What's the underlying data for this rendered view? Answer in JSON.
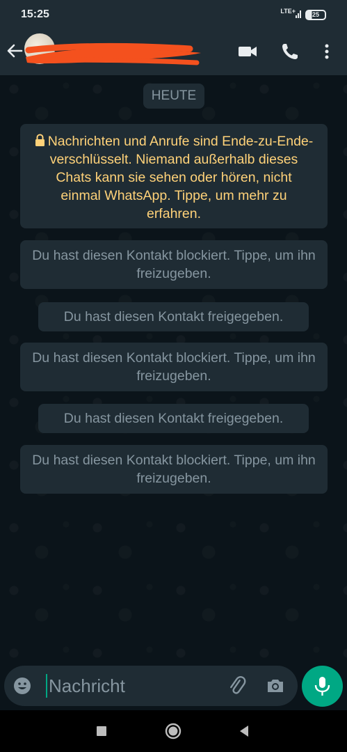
{
  "status_bar": {
    "time": "15:25",
    "network": "LTE+",
    "battery": "25"
  },
  "header": {
    "contact_name": "",
    "icons": [
      "back-arrow-icon",
      "video-call-icon",
      "voice-call-icon",
      "more-options-icon"
    ]
  },
  "chat": {
    "date_chip": "HEUTE",
    "encryption_notice": "Nachrichten und Anrufe sind Ende-zu-Ende-verschlüsselt. Niemand außerhalb dieses Chats kann sie sehen oder hören, nicht einmal WhatsApp. Tippe, um mehr zu erfahren.",
    "system_messages": [
      "Du hast diesen Kontakt blockiert. Tippe, um ihn freizugeben.",
      "Du hast diesen Kontakt freigegeben.",
      "Du hast diesen Kontakt blockiert. Tippe, um ihn freizugeben.",
      "Du hast diesen Kontakt freigegeben.",
      "Du hast diesen Kontakt blockiert. Tippe, um ihn freizugeben."
    ]
  },
  "composer": {
    "placeholder": "Nachricht",
    "value": ""
  },
  "colors": {
    "accent": "#00a884",
    "bar_background": "#1f2c34",
    "chat_background": "#0b141a",
    "encryption_text": "#ffd279",
    "system_text": "#8696a0",
    "redaction": "#f4511e"
  }
}
